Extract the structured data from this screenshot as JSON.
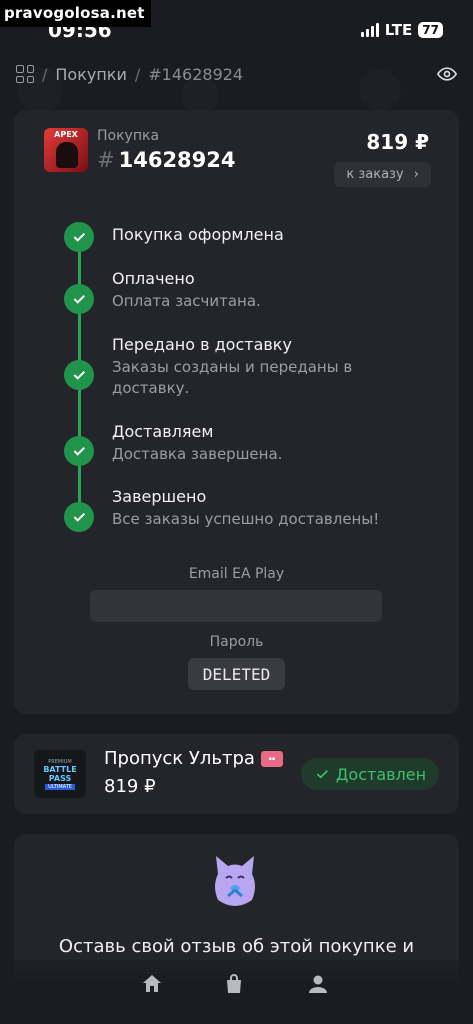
{
  "watermark": "pravogolosa.net",
  "status_bar": {
    "time": "09:56",
    "network": "LTE",
    "battery": "77"
  },
  "breadcrumb": {
    "section": "Покупки",
    "current": "#14628924"
  },
  "purchase": {
    "type_label": "Покупка",
    "hash": "#",
    "number": "14628924",
    "price": "819 ₽",
    "to_order_label": "к заказу",
    "logo_text": "APEX"
  },
  "timeline": [
    {
      "title": "Покупка оформлена",
      "desc": ""
    },
    {
      "title": "Оплачено",
      "desc": "Оплата засчитана."
    },
    {
      "title": "Передано в доставку",
      "desc": "Заказы созданы и переданы в доставку."
    },
    {
      "title": "Доставляем",
      "desc": "Доставка завершена."
    },
    {
      "title": "Завершено",
      "desc": "Все заказы успешно доставлены!"
    }
  ],
  "credentials": {
    "email_label": "Email EA Play",
    "email_value": "",
    "password_label": "Пароль",
    "password_value": "DELETED"
  },
  "item": {
    "name": "Пропуск Ультра",
    "price": "819 ₽",
    "status": "Доставлен",
    "image_text_top": "PREMIUM",
    "image_text_main": "BATTLE PASS",
    "image_text_tag": "ULTIMATE"
  },
  "review": {
    "text": "Оставь свой отзыв об этой покупке и"
  },
  "colors": {
    "accent_green": "#21944c",
    "status_green": "#3fbf6a",
    "card_bg": "#24252b",
    "page_bg": "#1b1c20"
  },
  "icons": [
    "grid-icon",
    "eye-icon",
    "check-icon",
    "chevron-right-icon",
    "ticket-icon",
    "home-icon",
    "bag-icon",
    "user-icon"
  ]
}
